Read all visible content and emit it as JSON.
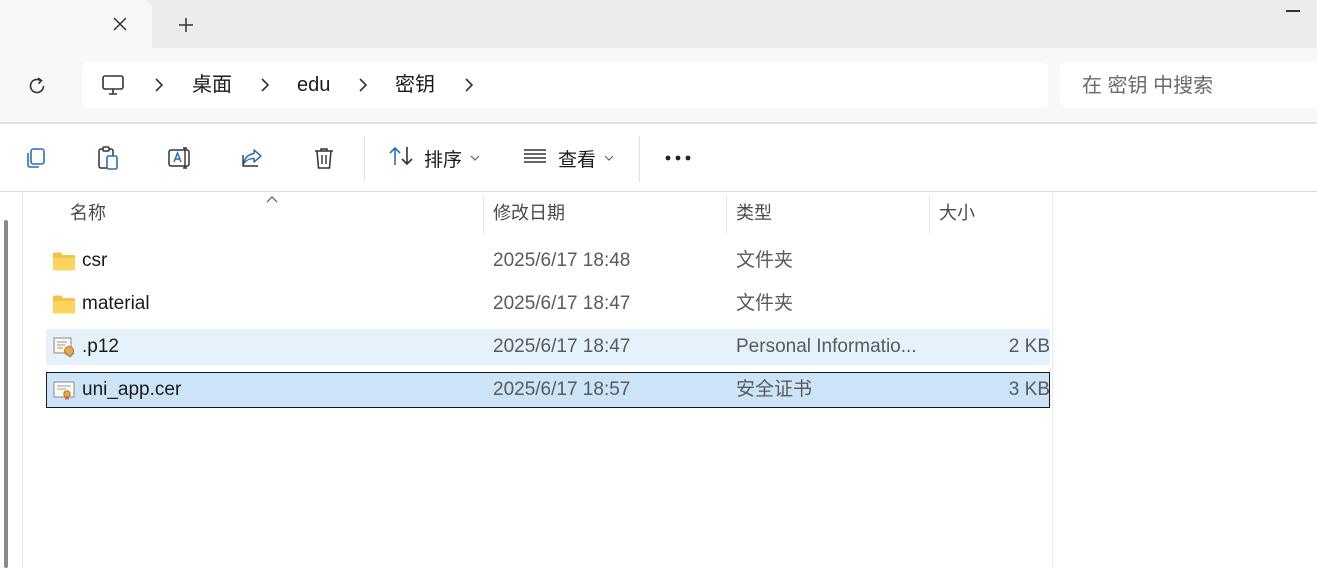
{
  "window": {
    "close_tab_icon": "close-icon",
    "new_tab_icon": "plus-icon"
  },
  "address": {
    "breadcrumb": [
      "桌面",
      "edu",
      "密钥"
    ],
    "search_placeholder": "在 密钥 中搜索"
  },
  "toolbar": {
    "sort_label": "排序",
    "view_label": "查看",
    "buttons": [
      "copy-icon",
      "paste-icon",
      "rename-icon",
      "share-icon",
      "delete-icon"
    ]
  },
  "columns": {
    "name": "名称",
    "date": "修改日期",
    "type": "类型",
    "size": "大小"
  },
  "files": [
    {
      "name": "csr",
      "date": "2025/6/17 18:48",
      "type": "文件夹",
      "size": "",
      "icon": "folder-icon"
    },
    {
      "name": "material",
      "date": "2025/6/17 18:47",
      "type": "文件夹",
      "size": "",
      "icon": "folder-icon"
    },
    {
      "name": ".p12",
      "date": "2025/6/17 18:47",
      "type": "Personal Informatio...",
      "size": "2 KB",
      "icon": "p12-file-icon"
    },
    {
      "name": "uni_app.cer",
      "date": "2025/6/17 18:57",
      "type": "安全证书",
      "size": "3 KB",
      "icon": "certificate-icon"
    }
  ],
  "colors": {
    "hover_row": "#e5f1fb",
    "selected_row": "#cce4f7",
    "folder": "#f5c24a"
  }
}
